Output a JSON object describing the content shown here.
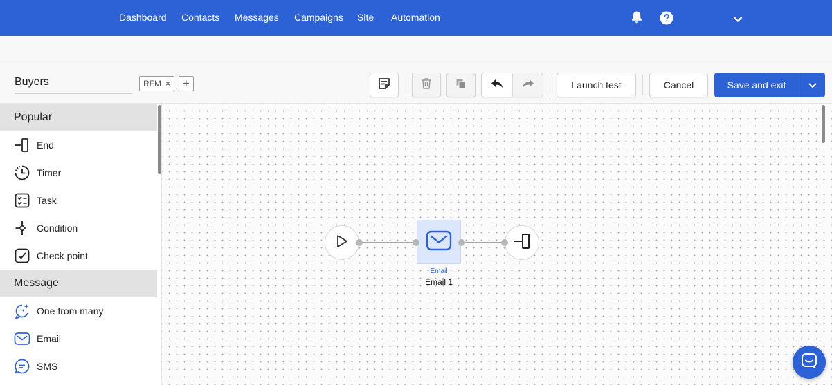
{
  "nav": {
    "links": [
      "Dashboard",
      "Contacts",
      "Messages",
      "Campaigns",
      "Site",
      "Automation"
    ]
  },
  "toolbar": {
    "flow_name": "Buyers",
    "tag": "RFM",
    "tag_remove": "×",
    "tag_add": "+",
    "launch_test_label": "Launch test",
    "cancel_label": "Cancel",
    "save_label": "Save and exit"
  },
  "sidebar": {
    "sections": [
      {
        "title": "Popular",
        "items": [
          {
            "label": "End",
            "icon": "end-icon"
          },
          {
            "label": "Timer",
            "icon": "timer-icon"
          },
          {
            "label": "Task",
            "icon": "task-icon"
          },
          {
            "label": "Condition",
            "icon": "condition-icon"
          },
          {
            "label": "Check point",
            "icon": "check-point-icon"
          }
        ]
      },
      {
        "title": "Message",
        "items": [
          {
            "label": "One from many",
            "icon": "sparkle-chat-icon"
          },
          {
            "label": "Email",
            "icon": "envelope-icon"
          },
          {
            "label": "SMS",
            "icon": "sms-icon"
          }
        ]
      }
    ]
  },
  "canvas": {
    "email_node": {
      "type_label": "Email",
      "name": "Email 1"
    }
  },
  "colors": {
    "brand": "#2d62d6",
    "email_node_bg": "#dce7fb",
    "section_header_bg": "#e2e2e2"
  }
}
